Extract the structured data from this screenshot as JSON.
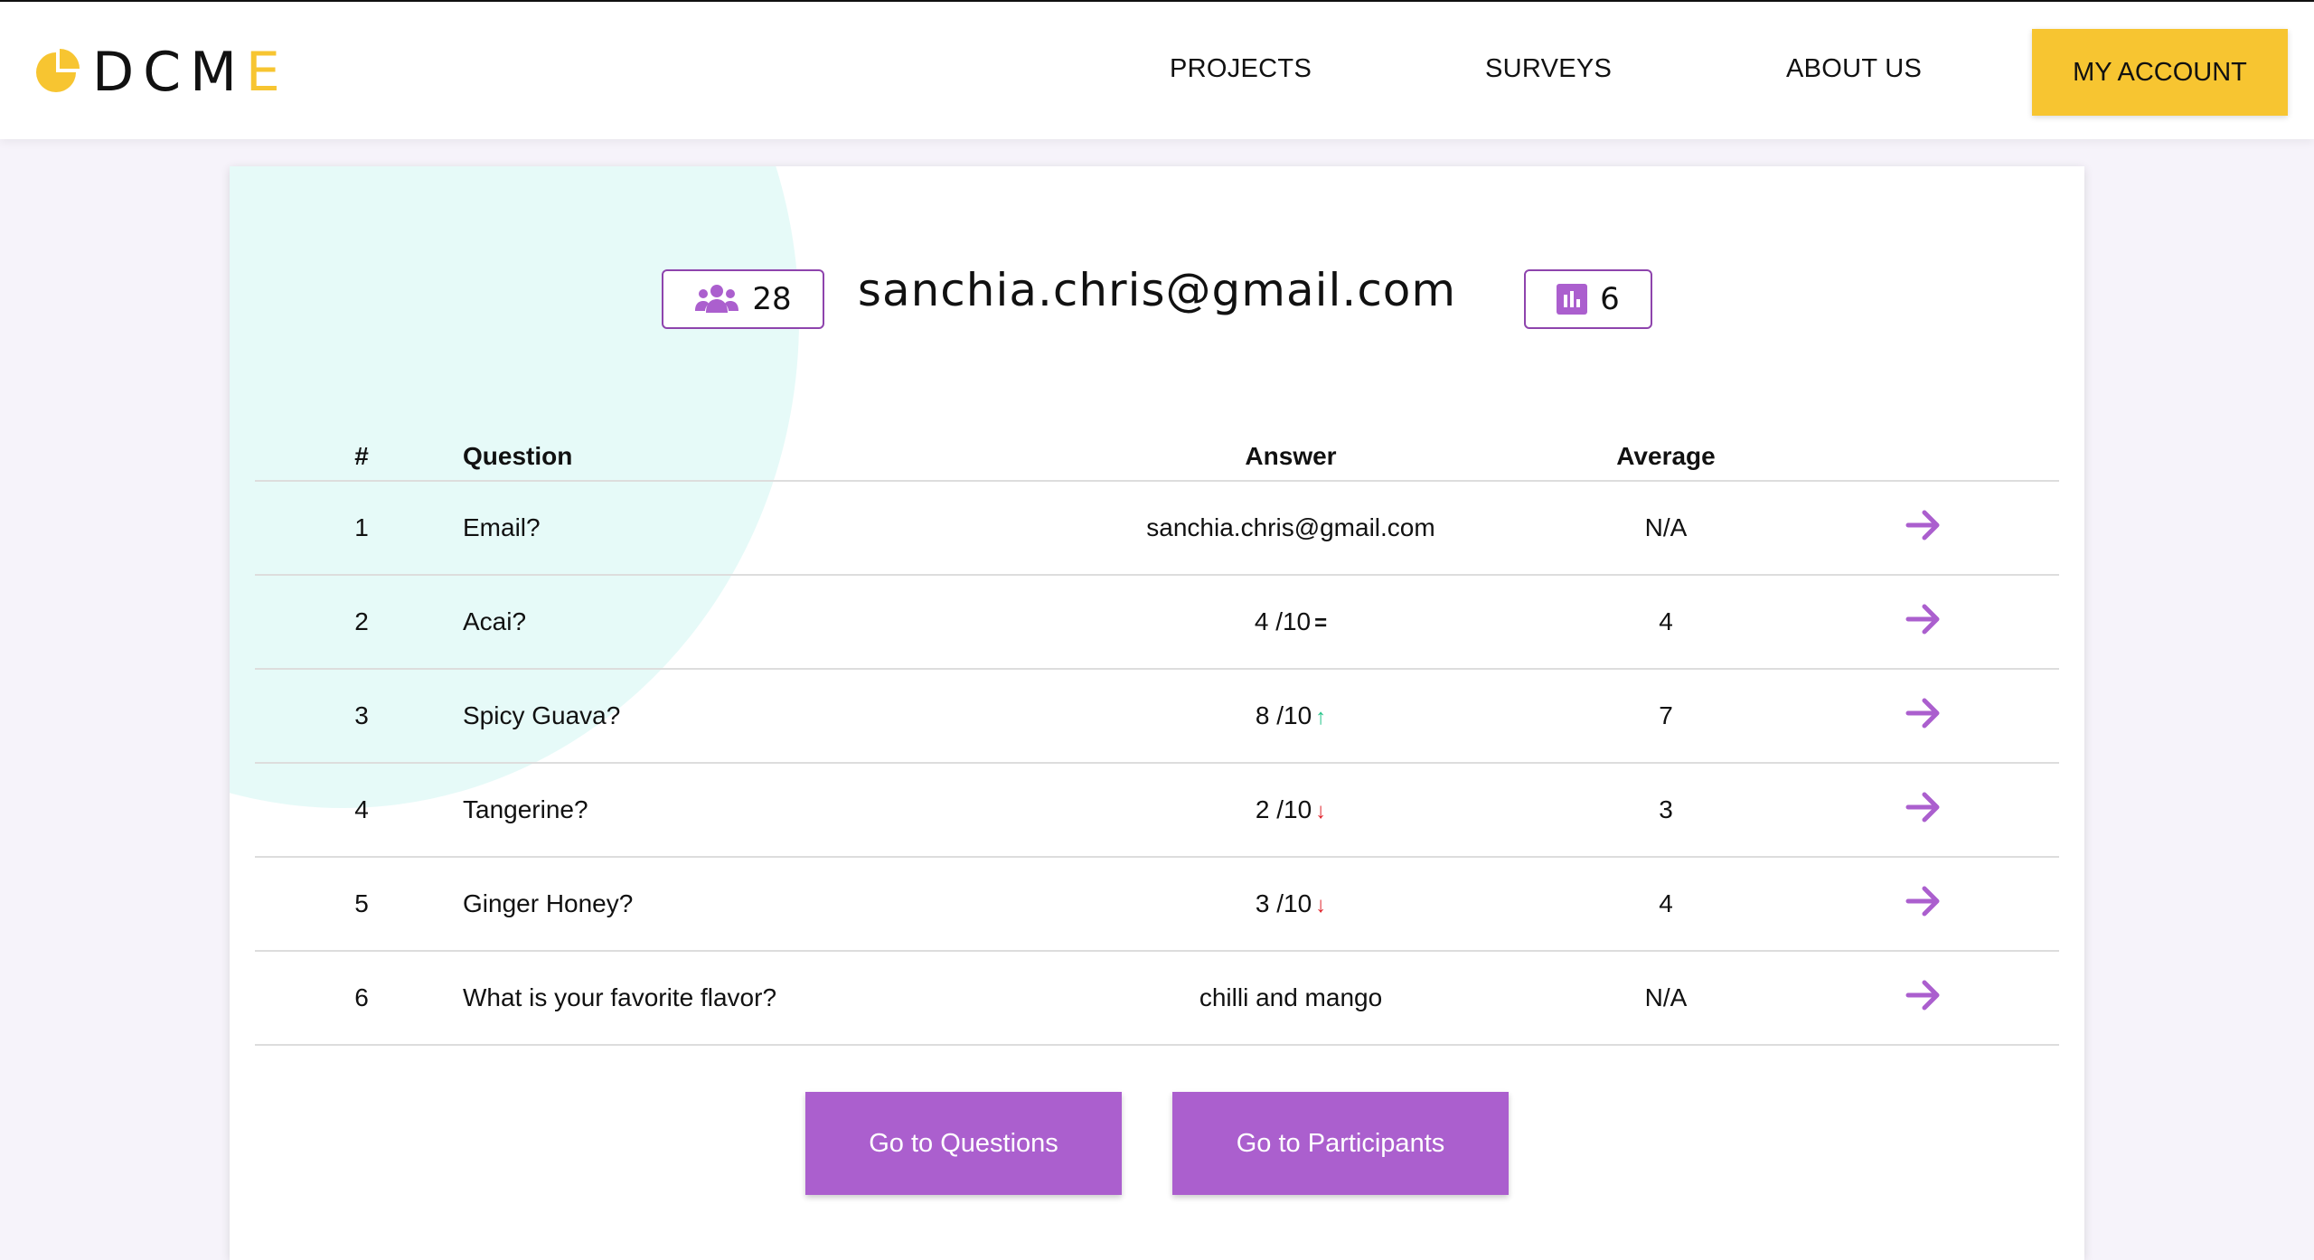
{
  "header": {
    "logo_text": "DCM",
    "logo_accent": "E",
    "nav": [
      {
        "label": "PROJECTS"
      },
      {
        "label": "SURVEYS"
      },
      {
        "label": "ABOUT US"
      }
    ],
    "account_label": "MY ACCOUNT"
  },
  "profile": {
    "participants_count": "28",
    "participants_icon": "users-icon",
    "email": "sanchia.chris@gmail.com",
    "surveys_count": "6",
    "surveys_icon": "bar-chart-icon"
  },
  "table": {
    "headers": {
      "num": "#",
      "question": "Question",
      "answer": "Answer",
      "average": "Average"
    },
    "rows": [
      {
        "num": "1",
        "question": "Email?",
        "answer": "sanchia.chris@gmail.com",
        "trend": "",
        "average": "N/A"
      },
      {
        "num": "2",
        "question": "Acai?",
        "answer": "4 /10",
        "trend": "=",
        "average": "4"
      },
      {
        "num": "3",
        "question": "Spicy Guava?",
        "answer": "8 /10",
        "trend": "↑",
        "average": "7"
      },
      {
        "num": "4",
        "question": "Tangerine?",
        "answer": "2 /10",
        "trend": "↓",
        "average": "3"
      },
      {
        "num": "5",
        "question": "Ginger Honey?",
        "answer": "3 /10",
        "trend": "↓",
        "average": "4"
      },
      {
        "num": "6",
        "question": "What is your favorite flavor?",
        "answer": "chilli and mango",
        "trend": "",
        "average": "N/A"
      }
    ]
  },
  "actions": {
    "questions_label": "Go to Questions",
    "participants_label": "Go to Participants"
  },
  "colors": {
    "brand_yellow": "#f7c531",
    "accent_purple": "#ab5fce",
    "trend_up": "#27c48a",
    "trend_down": "#e0242c",
    "deco_circle": "#e6faf8"
  }
}
